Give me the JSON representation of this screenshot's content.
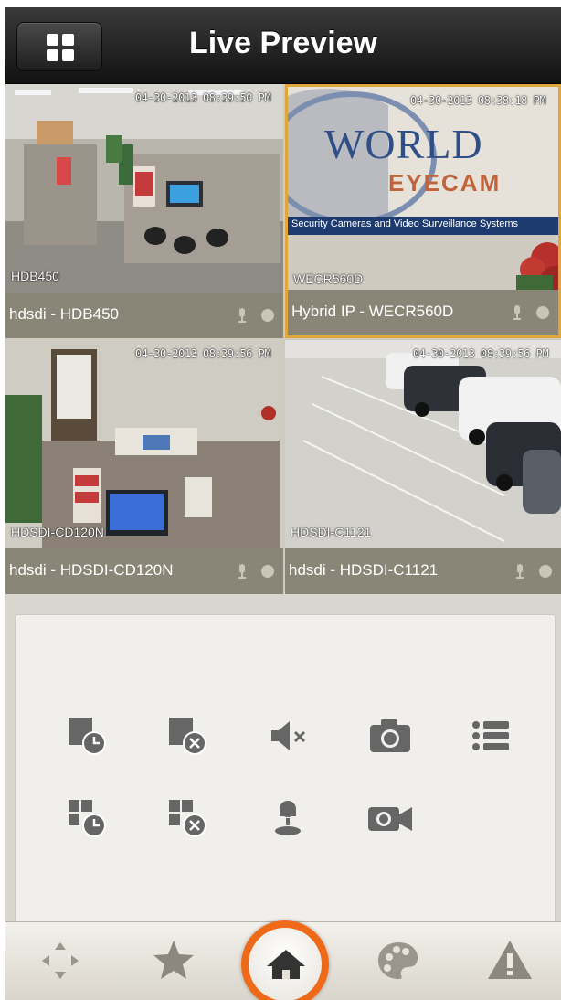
{
  "header": {
    "title": "Live Preview",
    "grid_button_icon": "grid-icon"
  },
  "cameras": [
    {
      "caption": "hdsdi - HDB450",
      "osd_label": "HDB450",
      "timestamp": "04-30-2013 08:39:50 PM",
      "selected": false
    },
    {
      "caption": "Hybrid IP - WECR560D",
      "osd_label": "WECR560D",
      "timestamp": "04-30-2013 08:38:18 PM",
      "selected": true,
      "signage_line1": "WORLD",
      "signage_line2": "EYECAM",
      "signage_tagline": "Security Cameras and Video Surveillance Systems"
    },
    {
      "caption": "hdsdi - HDSDI-CD120N",
      "osd_label": "HDSDI-CD120N",
      "timestamp": "04-30-2013 08:39:56 PM",
      "selected": false
    },
    {
      "caption": "hdsdi - HDSDI-C1121",
      "osd_label": "HDSDI-C1121",
      "timestamp": "04-30-2013 08:39:56 PM",
      "selected": false
    }
  ],
  "controls": {
    "row1": [
      "record-schedule-icon",
      "stop-record-icon",
      "mute-icon",
      "snapshot-icon",
      "list-icon"
    ],
    "row2": [
      "record-all-schedule-icon",
      "stop-all-record-icon",
      "talk-icon",
      "video-record-icon"
    ]
  },
  "tabbar": {
    "items": [
      "ptz-icon",
      "favorites-icon",
      "home-icon",
      "palette-icon",
      "alarm-icon"
    ],
    "active": "home-icon"
  },
  "colors": {
    "header": "#1e1e1e",
    "caption_bar": "#8a8677",
    "selected_border": "#e0a63a",
    "home_ring": "#ef6a18",
    "icon_gray": "#555555"
  }
}
